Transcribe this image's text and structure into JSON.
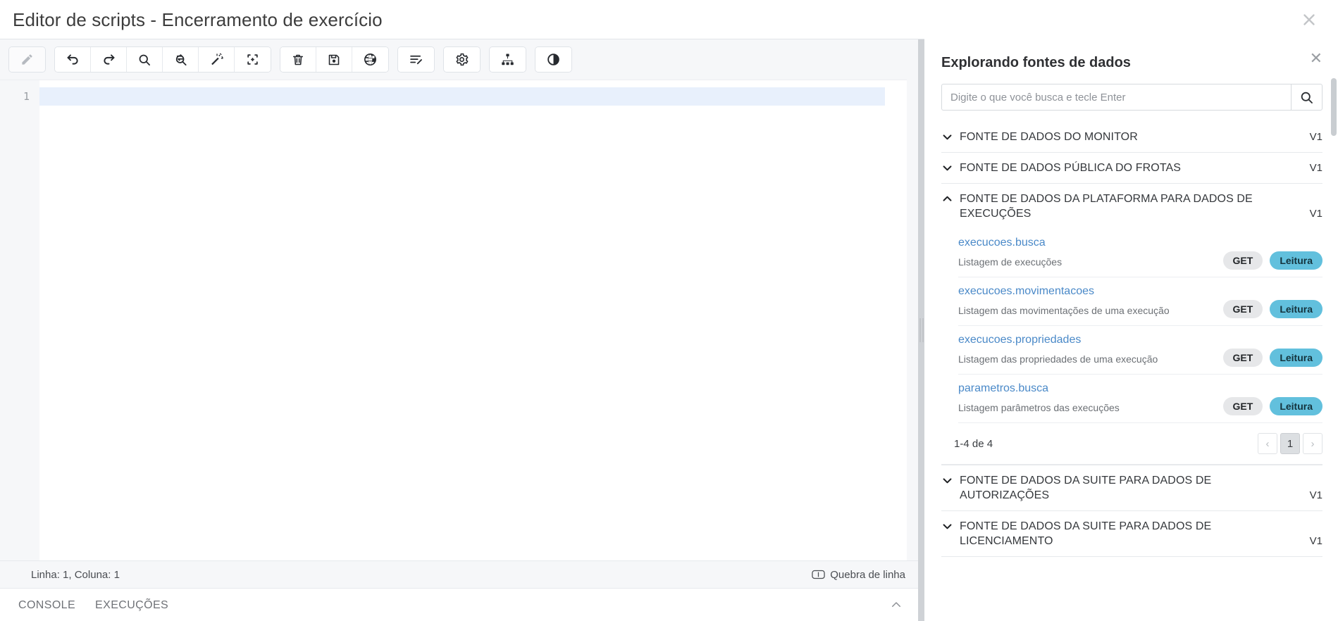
{
  "dialog": {
    "title": "Editor de scripts - Encerramento de exercício",
    "close_label": "✕"
  },
  "toolbar": {
    "groups": [
      {
        "buttons": [
          {
            "name": "edit-pencil-icon",
            "label": "Editar",
            "icon": "pencil-icon",
            "disabled": true
          }
        ]
      },
      {
        "buttons": [
          {
            "name": "undo-button",
            "label": "Desfazer",
            "icon": "undo-icon",
            "disabled": false
          },
          {
            "name": "redo-button",
            "label": "Refazer",
            "icon": "redo-icon",
            "disabled": false
          },
          {
            "name": "find-button",
            "label": "Localizar",
            "icon": "search-icon",
            "disabled": false
          },
          {
            "name": "find-replace-button",
            "label": "Localizar e substituir",
            "icon": "search-replace-icon",
            "disabled": false
          },
          {
            "name": "format-button",
            "label": "Formatar",
            "icon": "magic-wand-icon",
            "disabled": false
          },
          {
            "name": "collapse-button",
            "label": "Recolher",
            "icon": "collapse-icon",
            "disabled": false
          }
        ]
      },
      {
        "buttons": [
          {
            "name": "delete-button",
            "label": "Excluir",
            "icon": "trash-icon",
            "disabled": false
          },
          {
            "name": "save-button",
            "label": "Salvar",
            "icon": "save-icon",
            "disabled": false
          },
          {
            "name": "publish-button",
            "label": "Publicar",
            "icon": "globe-icon",
            "disabled": false
          }
        ]
      },
      {
        "buttons": [
          {
            "name": "parameters-button",
            "label": "Parâmetros",
            "icon": "edit-list-icon",
            "disabled": false
          }
        ]
      },
      {
        "buttons": [
          {
            "name": "settings-button",
            "label": "Configurações",
            "icon": "gear-icon",
            "disabled": false
          }
        ]
      },
      {
        "buttons": [
          {
            "name": "hierarchy-button",
            "label": "Hierarquia",
            "icon": "sitemap-icon",
            "disabled": false
          }
        ]
      },
      {
        "buttons": [
          {
            "name": "theme-button",
            "label": "Tema",
            "icon": "contrast-icon",
            "disabled": false
          }
        ]
      }
    ]
  },
  "editor": {
    "line_numbers": [
      "1"
    ],
    "lines": [
      ""
    ]
  },
  "status_bar": {
    "position": "Linha: 1, Coluna: 1",
    "wrap_label": "Quebra de linha",
    "wrap_icon": "word-wrap-icon"
  },
  "bottom_tabs": {
    "tabs": [
      {
        "name": "tab-console",
        "label": "CONSOLE"
      },
      {
        "name": "tab-execucoes",
        "label": "EXECUÇÕES"
      }
    ],
    "collapse_icon": "chevron-up-icon"
  },
  "panel": {
    "title": "Explorando fontes de dados",
    "close_label": "✕",
    "search": {
      "placeholder": "Digite o que você busca e tecle Enter",
      "value": "",
      "button_icon": "search-icon"
    },
    "sections": [
      {
        "name": "FONTE DE DADOS DO MONITOR",
        "version": "V1",
        "expanded": false,
        "endpoints": []
      },
      {
        "name": "FONTE DE DADOS PÚBLICA DO FROTAS",
        "version": "V1",
        "expanded": false,
        "endpoints": []
      },
      {
        "name": "FONTE DE DADOS DA PLATAFORMA PARA DADOS DE EXECUÇÕES",
        "version": "V1",
        "expanded": true,
        "endpoints": [
          {
            "name": "execucoes.busca",
            "description": "Listagem de execuções",
            "method": "GET",
            "access": "Leitura"
          },
          {
            "name": "execucoes.movimentacoes",
            "description": "Listagem das movimentações de uma execução",
            "method": "GET",
            "access": "Leitura"
          },
          {
            "name": "execucoes.propriedades",
            "description": "Listagem das propriedades de uma execução",
            "method": "GET",
            "access": "Leitura"
          },
          {
            "name": "parametros.busca",
            "description": "Listagem parâmetros das execuções",
            "method": "GET",
            "access": "Leitura"
          }
        ],
        "pagination": {
          "range_label": "1-4 de 4",
          "prev_label": "‹",
          "current_page": "1",
          "next_label": "›"
        }
      },
      {
        "name": "FONTE DE DADOS DA SUITE PARA DADOS DE AUTORIZAÇÕES",
        "version": "V1",
        "expanded": false,
        "endpoints": []
      },
      {
        "name": "FONTE DE DADOS DA SUITE PARA DADOS DE LICENCIAMENTO",
        "version": "V1",
        "expanded": false,
        "endpoints": []
      }
    ]
  },
  "colors": {
    "accent_link": "#4a89c8",
    "badge_access_bg": "#62c0dd",
    "badge_method_bg": "#e6e7e9",
    "active_line": "#e8f0fc",
    "chrome_bg": "#f6f7f9"
  }
}
